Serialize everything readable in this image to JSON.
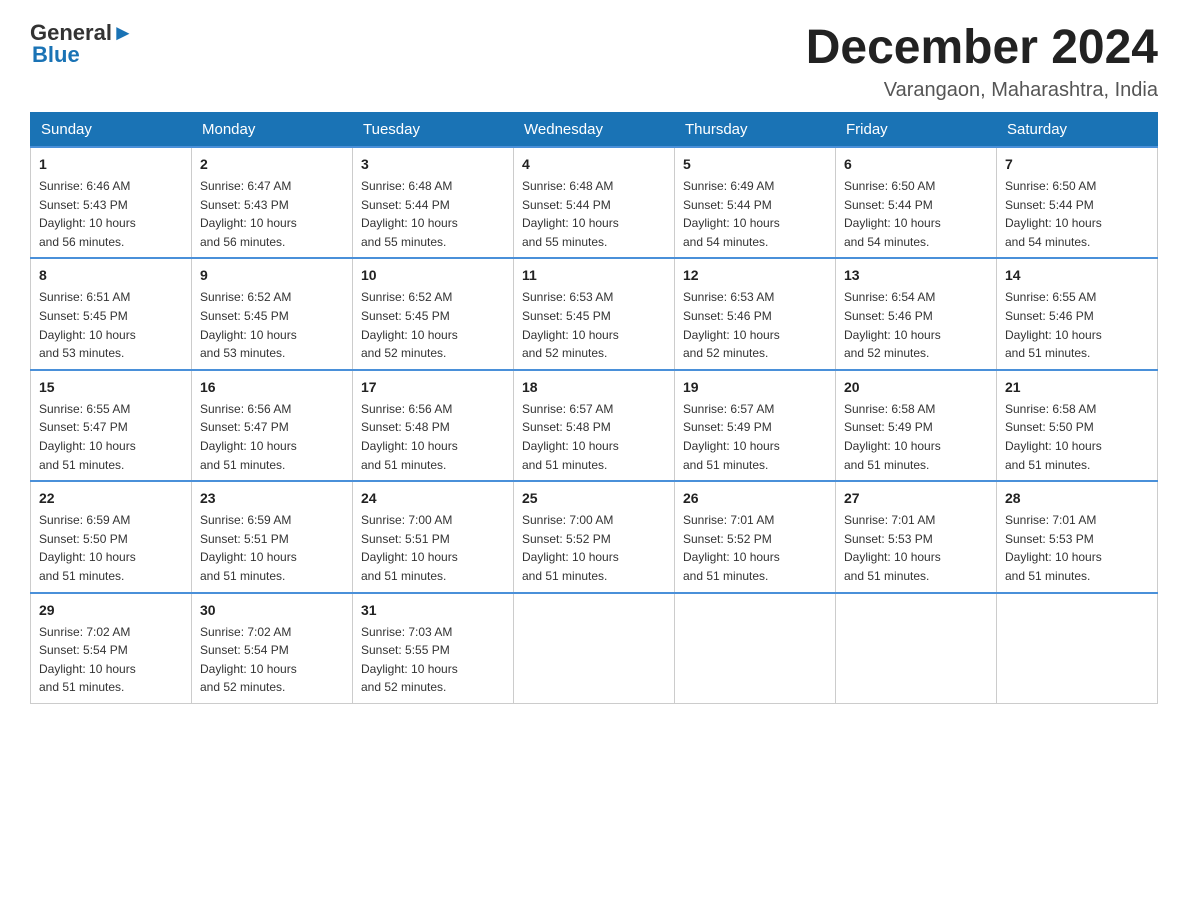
{
  "header": {
    "logo_line1": "General",
    "logo_line2": "Blue",
    "month_title": "December 2024",
    "location": "Varangaon, Maharashtra, India"
  },
  "days_of_week": [
    "Sunday",
    "Monday",
    "Tuesday",
    "Wednesday",
    "Thursday",
    "Friday",
    "Saturday"
  ],
  "weeks": [
    [
      {
        "day": "1",
        "sunrise": "6:46 AM",
        "sunset": "5:43 PM",
        "daylight": "10 hours and 56 minutes."
      },
      {
        "day": "2",
        "sunrise": "6:47 AM",
        "sunset": "5:43 PM",
        "daylight": "10 hours and 56 minutes."
      },
      {
        "day": "3",
        "sunrise": "6:48 AM",
        "sunset": "5:44 PM",
        "daylight": "10 hours and 55 minutes."
      },
      {
        "day": "4",
        "sunrise": "6:48 AM",
        "sunset": "5:44 PM",
        "daylight": "10 hours and 55 minutes."
      },
      {
        "day": "5",
        "sunrise": "6:49 AM",
        "sunset": "5:44 PM",
        "daylight": "10 hours and 54 minutes."
      },
      {
        "day": "6",
        "sunrise": "6:50 AM",
        "sunset": "5:44 PM",
        "daylight": "10 hours and 54 minutes."
      },
      {
        "day": "7",
        "sunrise": "6:50 AM",
        "sunset": "5:44 PM",
        "daylight": "10 hours and 54 minutes."
      }
    ],
    [
      {
        "day": "8",
        "sunrise": "6:51 AM",
        "sunset": "5:45 PM",
        "daylight": "10 hours and 53 minutes."
      },
      {
        "day": "9",
        "sunrise": "6:52 AM",
        "sunset": "5:45 PM",
        "daylight": "10 hours and 53 minutes."
      },
      {
        "day": "10",
        "sunrise": "6:52 AM",
        "sunset": "5:45 PM",
        "daylight": "10 hours and 52 minutes."
      },
      {
        "day": "11",
        "sunrise": "6:53 AM",
        "sunset": "5:45 PM",
        "daylight": "10 hours and 52 minutes."
      },
      {
        "day": "12",
        "sunrise": "6:53 AM",
        "sunset": "5:46 PM",
        "daylight": "10 hours and 52 minutes."
      },
      {
        "day": "13",
        "sunrise": "6:54 AM",
        "sunset": "5:46 PM",
        "daylight": "10 hours and 52 minutes."
      },
      {
        "day": "14",
        "sunrise": "6:55 AM",
        "sunset": "5:46 PM",
        "daylight": "10 hours and 51 minutes."
      }
    ],
    [
      {
        "day": "15",
        "sunrise": "6:55 AM",
        "sunset": "5:47 PM",
        "daylight": "10 hours and 51 minutes."
      },
      {
        "day": "16",
        "sunrise": "6:56 AM",
        "sunset": "5:47 PM",
        "daylight": "10 hours and 51 minutes."
      },
      {
        "day": "17",
        "sunrise": "6:56 AM",
        "sunset": "5:48 PM",
        "daylight": "10 hours and 51 minutes."
      },
      {
        "day": "18",
        "sunrise": "6:57 AM",
        "sunset": "5:48 PM",
        "daylight": "10 hours and 51 minutes."
      },
      {
        "day": "19",
        "sunrise": "6:57 AM",
        "sunset": "5:49 PM",
        "daylight": "10 hours and 51 minutes."
      },
      {
        "day": "20",
        "sunrise": "6:58 AM",
        "sunset": "5:49 PM",
        "daylight": "10 hours and 51 minutes."
      },
      {
        "day": "21",
        "sunrise": "6:58 AM",
        "sunset": "5:50 PM",
        "daylight": "10 hours and 51 minutes."
      }
    ],
    [
      {
        "day": "22",
        "sunrise": "6:59 AM",
        "sunset": "5:50 PM",
        "daylight": "10 hours and 51 minutes."
      },
      {
        "day": "23",
        "sunrise": "6:59 AM",
        "sunset": "5:51 PM",
        "daylight": "10 hours and 51 minutes."
      },
      {
        "day": "24",
        "sunrise": "7:00 AM",
        "sunset": "5:51 PM",
        "daylight": "10 hours and 51 minutes."
      },
      {
        "day": "25",
        "sunrise": "7:00 AM",
        "sunset": "5:52 PM",
        "daylight": "10 hours and 51 minutes."
      },
      {
        "day": "26",
        "sunrise": "7:01 AM",
        "sunset": "5:52 PM",
        "daylight": "10 hours and 51 minutes."
      },
      {
        "day": "27",
        "sunrise": "7:01 AM",
        "sunset": "5:53 PM",
        "daylight": "10 hours and 51 minutes."
      },
      {
        "day": "28",
        "sunrise": "7:01 AM",
        "sunset": "5:53 PM",
        "daylight": "10 hours and 51 minutes."
      }
    ],
    [
      {
        "day": "29",
        "sunrise": "7:02 AM",
        "sunset": "5:54 PM",
        "daylight": "10 hours and 51 minutes."
      },
      {
        "day": "30",
        "sunrise": "7:02 AM",
        "sunset": "5:54 PM",
        "daylight": "10 hours and 52 minutes."
      },
      {
        "day": "31",
        "sunrise": "7:03 AM",
        "sunset": "5:55 PM",
        "daylight": "10 hours and 52 minutes."
      },
      null,
      null,
      null,
      null
    ]
  ],
  "labels": {
    "sunrise_prefix": "Sunrise: ",
    "sunset_prefix": "Sunset: ",
    "daylight_prefix": "Daylight: "
  }
}
